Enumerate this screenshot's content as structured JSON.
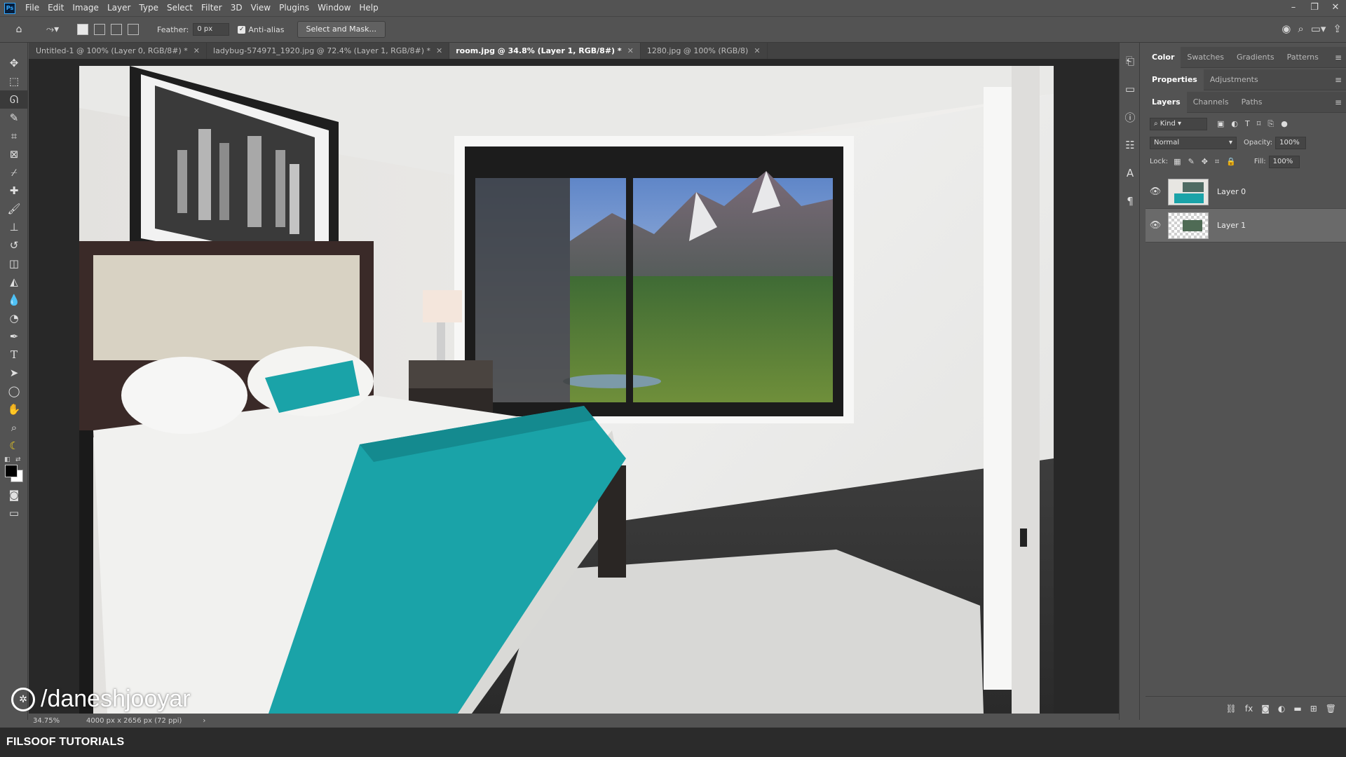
{
  "menu": {
    "items": [
      "File",
      "Edit",
      "Image",
      "Layer",
      "Type",
      "Select",
      "Filter",
      "3D",
      "View",
      "Plugins",
      "Window",
      "Help"
    ],
    "logo": "Ps"
  },
  "options": {
    "feather_label": "Feather:",
    "feather_value": "0 px",
    "antialias_label": "Anti-alias",
    "select_mask": "Select and Mask..."
  },
  "tabs": [
    {
      "label": "Untitled-1 @ 100% (Layer 0, RGB/8#) *",
      "active": false
    },
    {
      "label": "ladybug-574971_1920.jpg @ 72.4% (Layer 1, RGB/8#) *",
      "active": false
    },
    {
      "label": "room.jpg @ 34.8% (Layer 1, RGB/8#) *",
      "active": true
    },
    {
      "label": "1280.jpg @ 100% (RGB/8)",
      "active": false
    }
  ],
  "status": {
    "zoom": "34.75%",
    "doc_info": "4000 px x 2656 px (72 ppi)",
    "arrow": "›"
  },
  "panels": {
    "color_tabs": [
      "Color",
      "Swatches",
      "Gradients",
      "Patterns"
    ],
    "properties_tabs": [
      "Properties",
      "Adjustments"
    ],
    "layers_tabs": [
      "Layers",
      "Channels",
      "Paths"
    ],
    "kind_label": "Kind",
    "blend_mode": "Normal",
    "opacity_label": "Opacity:",
    "opacity_value": "100%",
    "lock_label": "Lock:",
    "fill_label": "Fill:",
    "fill_value": "100%",
    "layers": [
      {
        "name": "Layer 0",
        "selected": false
      },
      {
        "name": "Layer 1",
        "selected": true
      }
    ]
  },
  "watermark": "/daneshjooyar",
  "brand": "FILSOOF TUTORIALS",
  "colors": {
    "app_bg": "#535353",
    "canvas_bg": "#282828",
    "accent": "#31a8ff",
    "teal": "#1aa3a8",
    "logo_circle": "#1565c0"
  }
}
